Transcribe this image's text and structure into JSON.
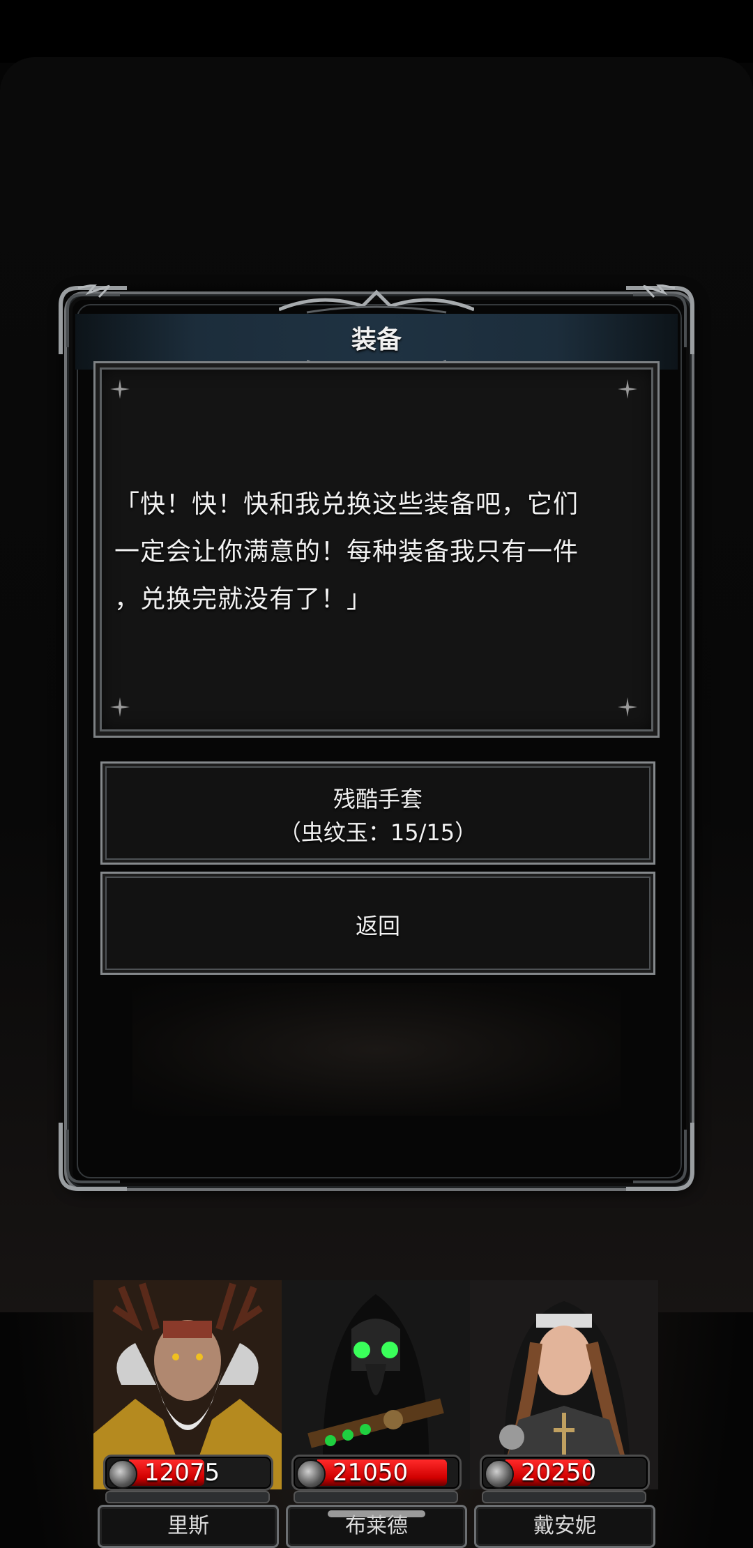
{
  "dialog": {
    "title": "装备",
    "message_lines": [
      "「快！快！快和我兑换这些装备吧，它们",
      "一定会让你满意的！每种装备我只有一件",
      "，兑换完就没有了！」"
    ]
  },
  "options": [
    {
      "line1": "残酷手套",
      "line2": "（虫纹玉：15/15）"
    },
    {
      "label": "返回"
    }
  ],
  "party": [
    {
      "name": "里斯",
      "hp": "12075",
      "hp_fill": 0.55,
      "portrait": "druid-antlers"
    },
    {
      "name": "布莱德",
      "hp": "21050",
      "hp_fill": 0.95,
      "portrait": "plague-doctor"
    },
    {
      "name": "戴安妮",
      "hp": "20250",
      "hp_fill": 0.62,
      "portrait": "nun-warrior"
    }
  ],
  "colors": {
    "hp_red": "#d00000",
    "frame_silver": "#7d8184",
    "title_blue": "#1f3242"
  }
}
